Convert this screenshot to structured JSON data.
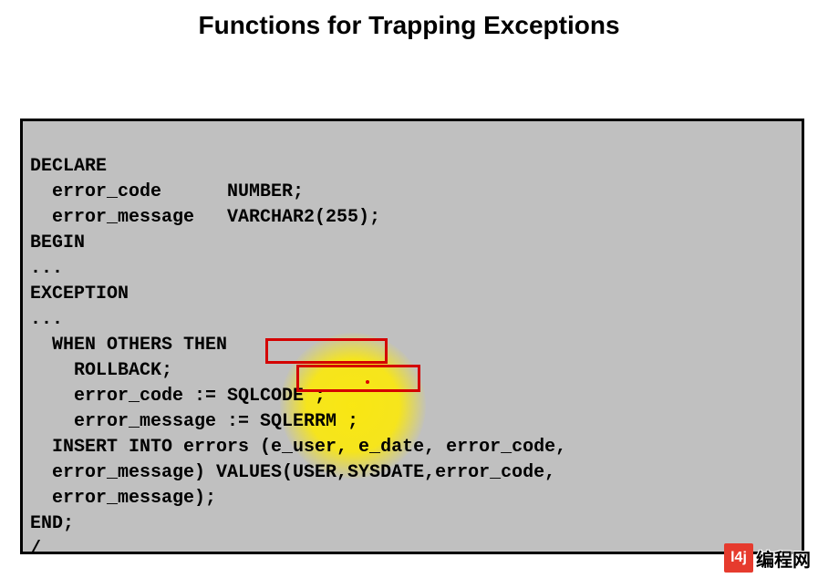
{
  "title": "Functions for Trapping Exceptions",
  "code": {
    "l1": "DECLARE",
    "l2": "  error_code      NUMBER;",
    "l3": "  error_message   VARCHAR2(255);",
    "l4": "BEGIN",
    "l5": "...",
    "l6": "EXCEPTION",
    "l7": "...",
    "l8": "  WHEN OTHERS THEN",
    "l9": "    ROLLBACK;",
    "l10": "    error_code := SQLCODE ;",
    "l11": "    error_message := SQLERRM ;",
    "l12": "  INSERT INTO errors (e_user, e_date, error_code,",
    "l13": "  error_message) VALUES(USER,SYSDATE,error_code,",
    "l14": "  error_message);",
    "l15": "END;",
    "l16": "/"
  },
  "highlighted_tokens": {
    "box1": "SQLCODE ;",
    "box2": "SQLERRM ;"
  },
  "logo": {
    "square": "l4j",
    "text": "编程网"
  }
}
